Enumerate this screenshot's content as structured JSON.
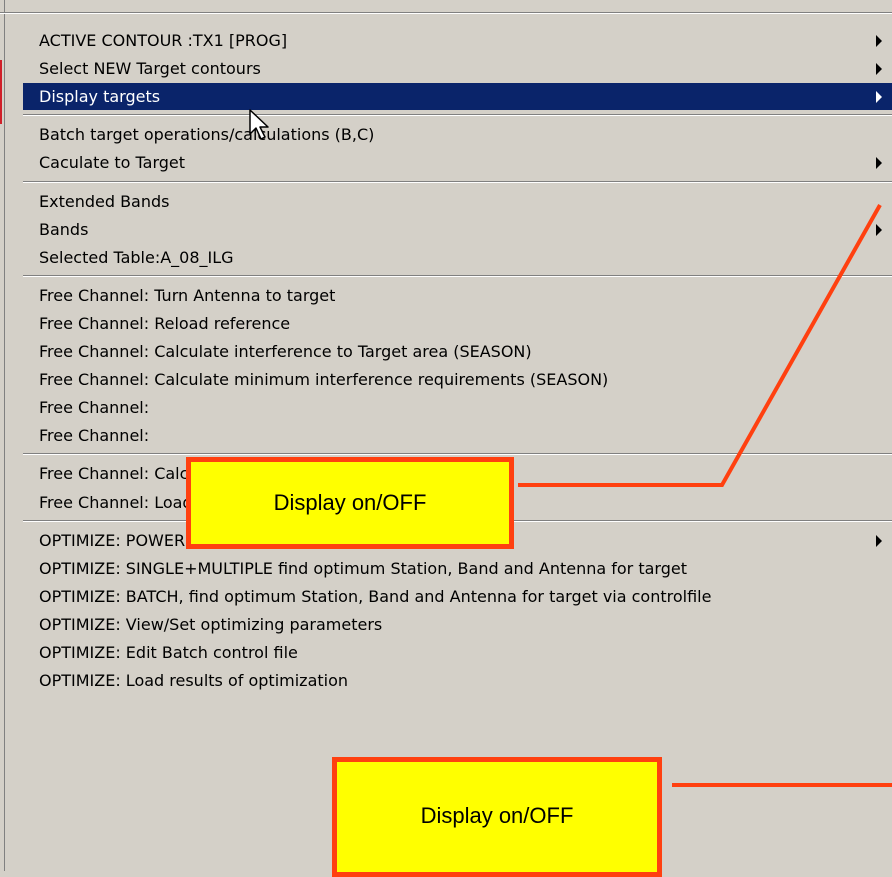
{
  "menu": {
    "groups": [
      [
        {
          "label": "ACTIVE CONTOUR :TX1 [PROG]",
          "submenu": true
        },
        {
          "label": "Select NEW Target contours",
          "submenu": true
        },
        {
          "label": "Display targets",
          "submenu": true,
          "selected": true
        }
      ],
      [
        {
          "label": "Batch target operations/calculations (B,C)",
          "submenu": false
        },
        {
          "label": "Caculate to Target",
          "submenu": true
        }
      ],
      [
        {
          "label": "Extended Bands",
          "submenu": false
        },
        {
          "label": "Bands",
          "submenu": true
        },
        {
          "label": "Selected Table:A_08_ILG",
          "submenu": false
        }
      ],
      [
        {
          "label": "Free Channel: Turn Antenna to target",
          "submenu": false
        },
        {
          "label": "Free Channel: Reload reference",
          "submenu": false
        },
        {
          "label": "Free Channel: Calculate interference to Target area (SEASON)",
          "submenu": false
        },
        {
          "label": "Free Channel: Calculate minimum interference requirements (SEASON)",
          "submenu": false
        },
        {
          "label": "Free Channel:",
          "submenu": false
        },
        {
          "label": "Free Channel:",
          "submenu": false
        }
      ],
      [
        {
          "label": "Free Channel: Calculate Free+Impact",
          "submenu": false
        },
        {
          "label": "Free Channel: Load FREE+IMPACT",
          "submenu": false
        }
      ],
      [
        {
          "label": "OPTIMIZE: POWER",
          "submenu": true
        },
        {
          "label": "OPTIMIZE: SINGLE+MULTIPLE find optimum Station, Band and Antenna for target",
          "submenu": false
        },
        {
          "label": "OPTIMIZE: BATCH, find optimum Station, Band and Antenna for target via controlfile",
          "submenu": false
        },
        {
          "label": "OPTIMIZE: View/Set optimizing parameters",
          "submenu": false
        },
        {
          "label": "OPTIMIZE: Edit Batch control file",
          "submenu": false
        },
        {
          "label": "OPTIMIZE: Load results of optimization",
          "submenu": false
        }
      ]
    ]
  },
  "callouts": {
    "top_label": "Display on/OFF",
    "bottom_label": "Display on/OFF"
  },
  "colors": {
    "selection": "#0a246a",
    "callout_fill": "#ffff00",
    "callout_border": "#ff4010"
  },
  "icons": [
    "arrow-cursor-icon",
    "submenu-arrow-icon"
  ]
}
